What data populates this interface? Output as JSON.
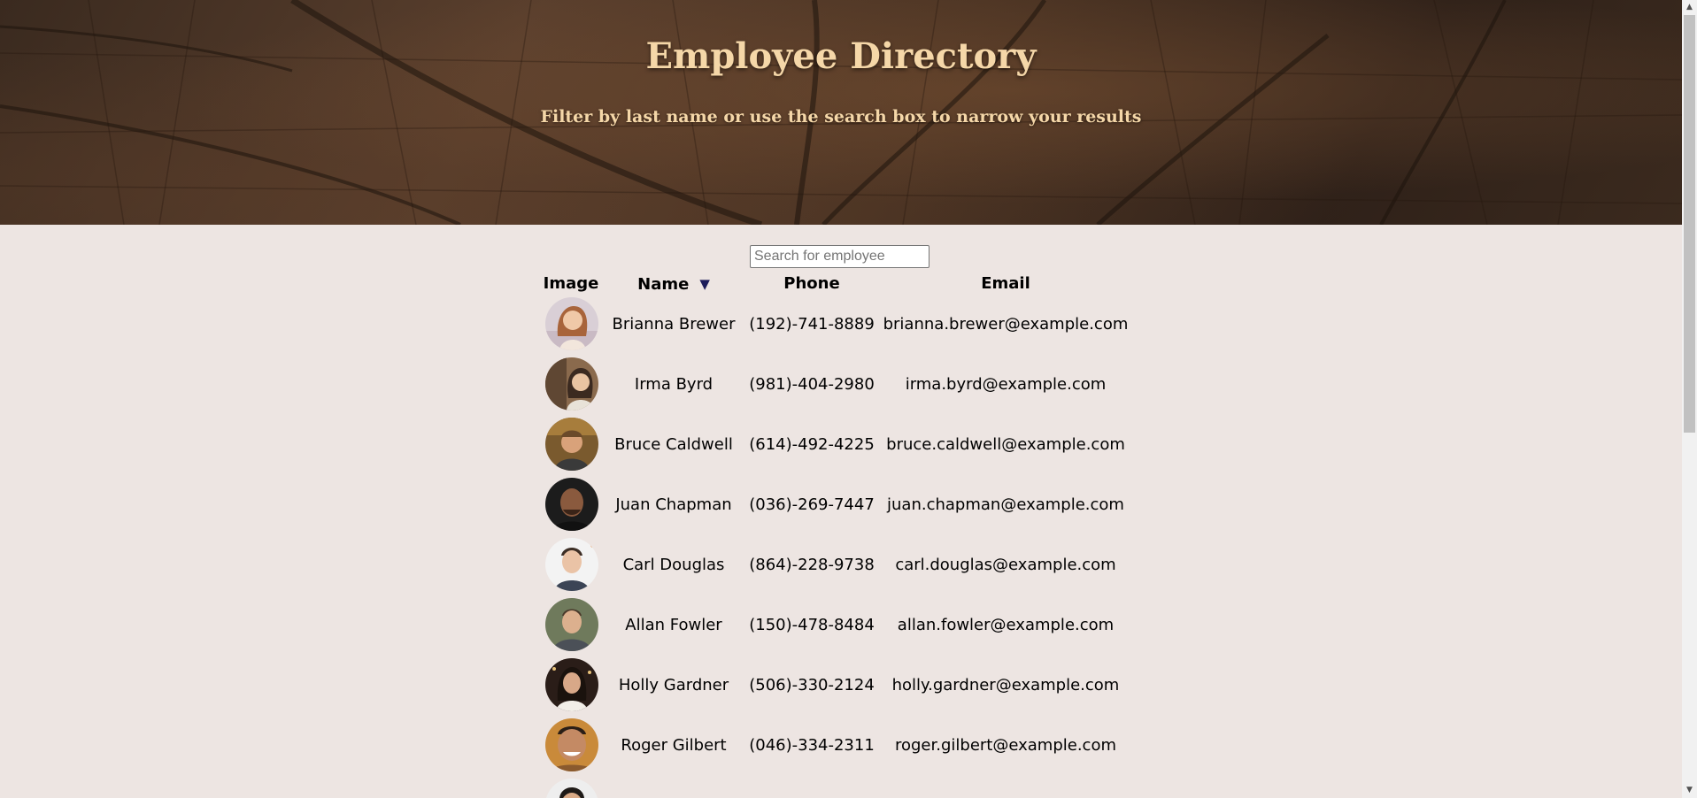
{
  "header": {
    "title": "Employee Directory",
    "subtitle": "Filter by last name or use the search box to narrow your results"
  },
  "search": {
    "placeholder": "Search for employee",
    "value": ""
  },
  "table": {
    "columns": {
      "image": "Image",
      "name": "Name",
      "phone": "Phone",
      "email": "Email"
    },
    "sort": {
      "column": "name",
      "direction": "descending-arrow",
      "icon": "triangle-down-icon",
      "glyph": "▼",
      "color": "#1c1c5a"
    },
    "rows": [
      {
        "name": "Brianna Brewer",
        "phone": "(192)-741-8889",
        "email": "brianna.brewer@example.com",
        "avatar": "photo-woman"
      },
      {
        "name": "Irma Byrd",
        "phone": "(981)-404-2980",
        "email": "irma.byrd@example.com",
        "avatar": "photo-woman"
      },
      {
        "name": "Bruce Caldwell",
        "phone": "(614)-492-4225",
        "email": "bruce.caldwell@example.com",
        "avatar": "photo-man"
      },
      {
        "name": "Juan Chapman",
        "phone": "(036)-269-7447",
        "email": "juan.chapman@example.com",
        "avatar": "photo-man"
      },
      {
        "name": "Carl Douglas",
        "phone": "(864)-228-9738",
        "email": "carl.douglas@example.com",
        "avatar": "photo-man"
      },
      {
        "name": "Allan Fowler",
        "phone": "(150)-478-8484",
        "email": "allan.fowler@example.com",
        "avatar": "photo-man"
      },
      {
        "name": "Holly Gardner",
        "phone": "(506)-330-2124",
        "email": "holly.gardner@example.com",
        "avatar": "photo-woman"
      },
      {
        "name": "Roger Gilbert",
        "phone": "(046)-334-2311",
        "email": "roger.gilbert@example.com",
        "avatar": "photo-man"
      },
      {
        "name": "",
        "phone": "",
        "email": "",
        "avatar": "photo-man"
      }
    ]
  },
  "colors": {
    "page_background": "#ede5e2",
    "title_color": "#f5d7a8",
    "banner_tone": "#3a2a1f"
  }
}
